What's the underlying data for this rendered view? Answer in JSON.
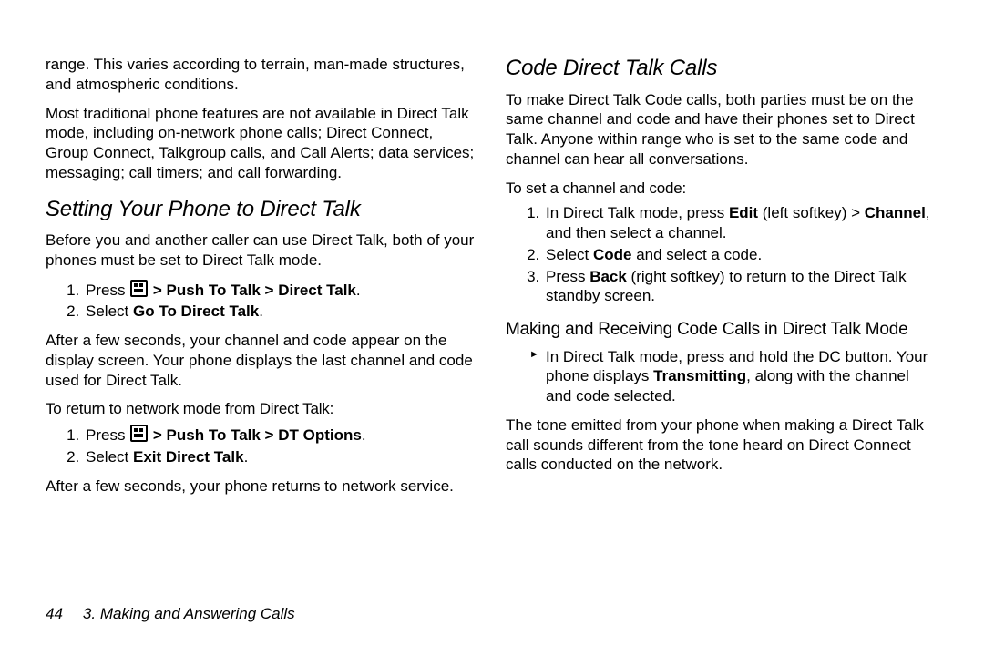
{
  "left": {
    "p1": "range. This varies according to terrain, man-made structures, and atmospheric conditions.",
    "p2": "Most traditional phone features are not available in Direct Talk mode, including on-network phone calls; Direct Connect, Group Connect, Talkgroup calls, and Call Alerts; data services; messaging; call timers; and call forwarding.",
    "h2": "Setting Your Phone to Direct Talk",
    "p3": "Before you and another caller can use Direct Talk, both of your phones must be set to Direct Talk mode.",
    "ol1": {
      "i1a": "Press ",
      "i1b": " > Push To Talk > Direct Talk",
      "i1c": ".",
      "i2a": "Select ",
      "i2b": "Go To Direct Talk",
      "i2c": "."
    },
    "p4": "After a few seconds, your channel and code appear on the display screen. Your phone displays the last channel and code used for Direct Talk.",
    "sub1": "To return to network mode from Direct Talk:",
    "ol2": {
      "i1a": "Press ",
      "i1b": " > Push To Talk > DT Options",
      "i1c": ".",
      "i2a": "Select ",
      "i2b": "Exit Direct Talk",
      "i2c": "."
    },
    "p5": "After a few seconds, your phone returns to network service."
  },
  "right": {
    "h2": "Code Direct Talk Calls",
    "p1": "To make Direct Talk Code calls, both parties must be on the same channel and code and have their phones set to Direct Talk. Anyone within range who is set to the same code and channel can hear all conversations.",
    "sub1": "To set a channel and code:",
    "ol1": {
      "i1a": "In Direct Talk mode, press ",
      "i1b": "Edit",
      "i1c": " (left softkey) > ",
      "i1d": "Channel",
      "i1e": ", and then select a channel.",
      "i2a": "Select ",
      "i2b": "Code",
      "i2c": " and select a code.",
      "i3a": "Press ",
      "i3b": "Back",
      "i3c": " (right softkey) to return to the Direct Talk standby screen."
    },
    "h3": "Making and Receiving Code Calls in Direct Talk Mode",
    "ul1": {
      "i1a": "In Direct Talk mode, press and hold the DC button. Your phone displays ",
      "i1b": "Transmitting",
      "i1c": ", along with the channel and code selected."
    },
    "p2": "The tone emitted from your phone when making a Direct Talk call sounds different from the tone heard on Direct Connect calls conducted on the network."
  },
  "footer": {
    "page": "44",
    "section": "3. Making and Answering Calls"
  }
}
